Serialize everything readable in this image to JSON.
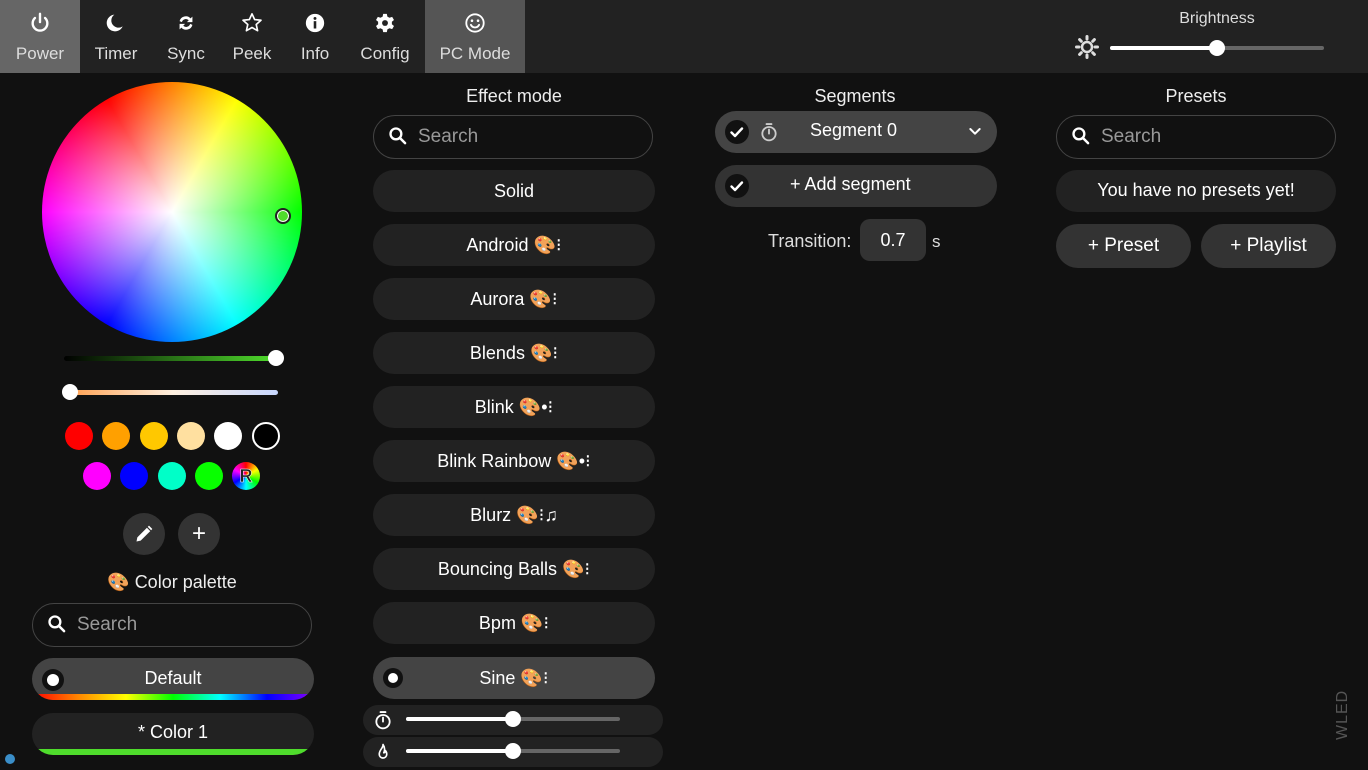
{
  "nav": {
    "tabs": [
      {
        "label": "Power",
        "icon": "power-icon"
      },
      {
        "label": "Timer",
        "icon": "moon-icon"
      },
      {
        "label": "Sync",
        "icon": "sync-icon"
      },
      {
        "label": "Peek",
        "icon": "star-icon"
      },
      {
        "label": "Info",
        "icon": "info-icon"
      },
      {
        "label": "Config",
        "icon": "gear-icon"
      },
      {
        "label": "PC Mode",
        "icon": "smile-icon"
      }
    ]
  },
  "brightness": {
    "label": "Brightness",
    "level": 0.5
  },
  "colors": {
    "swatches_row1": [
      "#ff0000",
      "#ffa000",
      "#ffc800",
      "#ffe0a0",
      "#ffffff",
      "#000000"
    ],
    "swatches_row2": [
      "#ff00ff",
      "#0000ff",
      "#00ffc8",
      "#08ff00"
    ],
    "random_label": "R"
  },
  "palette": {
    "title": "Color palette",
    "search_placeholder": "Search",
    "items": [
      "Default",
      "* Color 1"
    ]
  },
  "effects": {
    "title": "Effect mode",
    "search_placeholder": "Search",
    "items": [
      "Solid",
      "Android 🎨⁝",
      "Aurora 🎨⁝",
      "Blends 🎨⁝",
      "Blink 🎨•⁝",
      "Blink Rainbow 🎨•⁝",
      "Blurz 🎨⁝♫",
      "Bouncing Balls 🎨⁝",
      "Bpm 🎨⁝"
    ],
    "selected": "Sine 🎨⁝",
    "speed": 0.5,
    "intensity": 0.5
  },
  "segments": {
    "title": "Segments",
    "segment_name": "Segment 0",
    "add_label": "+ Add segment",
    "transition_label": "Transition:",
    "transition_value": "0.7",
    "transition_unit": "s"
  },
  "presets": {
    "title": "Presets",
    "search_placeholder": "Search",
    "empty_message": "You have no presets yet!",
    "add_preset": "+ Preset",
    "add_playlist": "+ Playlist"
  },
  "watermark": "WLED"
}
